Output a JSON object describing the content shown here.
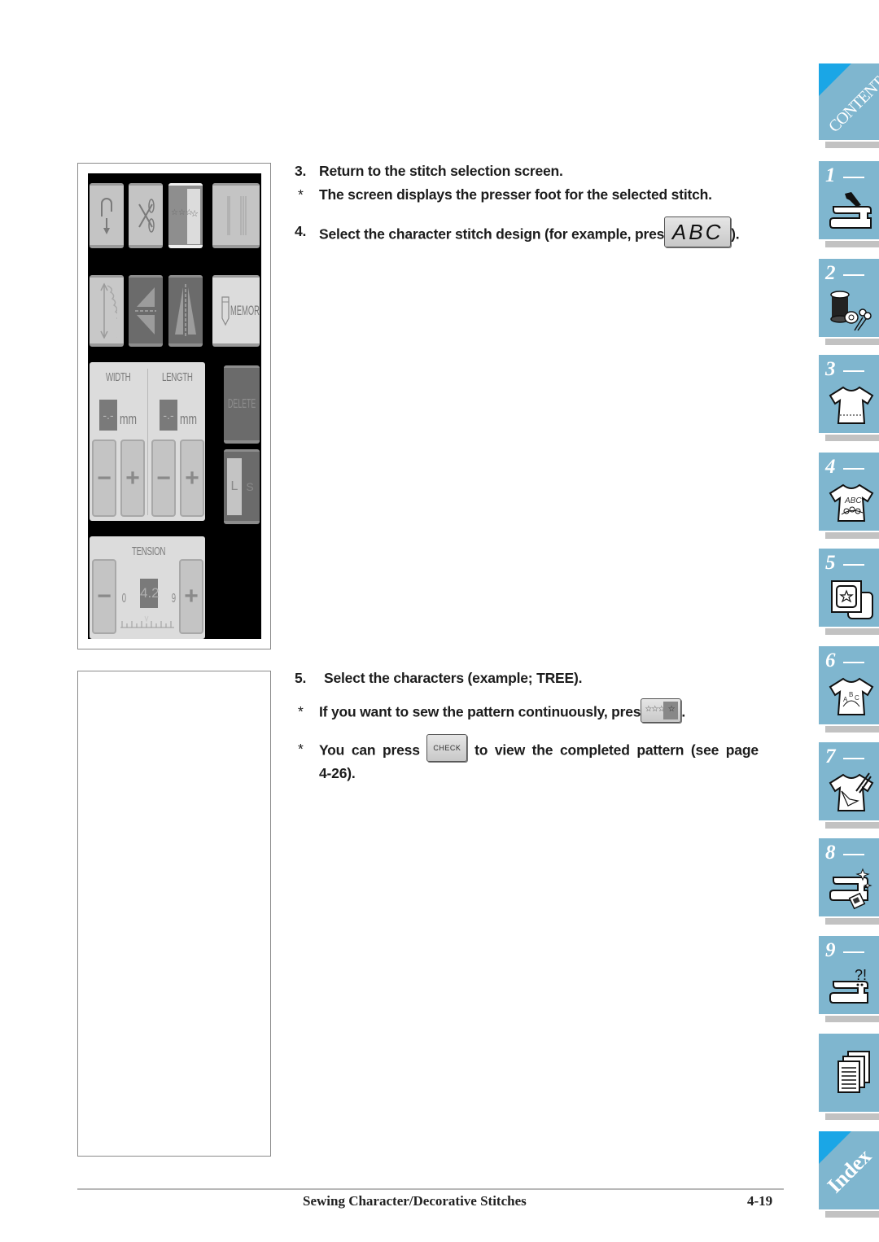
{
  "figure1": {
    "buttons_row1": [
      "reverse-stitch",
      "thread-cutter",
      "single-continuous",
      "needle-mode"
    ],
    "buttons_row2": [
      "elongation",
      "mirror-horizontal",
      "mirror-vertical",
      "memory"
    ],
    "memory_label": "MEMORY",
    "width_label": "WIDTH",
    "length_label": "LENGTH",
    "width_value": "-.-",
    "length_value": "-.-",
    "unit": "mm",
    "minus": "−",
    "plus": "+",
    "delete_label": "DELETE",
    "size_large": "L",
    "size_small": "S",
    "tension_label": "TENSION",
    "tension_value": "4.2",
    "tension_min": "0",
    "tension_max": "9"
  },
  "steps": {
    "s3_num": "3.",
    "s3_text": "Return to the stitch selection screen.",
    "s3_note_bullet": "*",
    "s3_note": "The screen displays the presser foot for the selected stitch.",
    "s4_num": "4.",
    "s4_text_before": "Select the character stitch design (for example, pres",
    "s4_button": "ABC",
    "s4_text_after": ").",
    "s5_num": "5.",
    "s5_text": "Select the characters (example; TREE).",
    "s5_note1_bullet": "*",
    "s5_note1_before": "If you want to sew the pattern continuously, pres",
    "s5_note1_button_stars": "☆☆☆",
    "s5_note1_button_star": "☆",
    "s5_note1_after": ".",
    "s5_note2_bullet": "*",
    "s5_note2_before": "You can press",
    "s5_note2_button": "CHECK",
    "s5_note2_after": "to view the completed pattern (see page",
    "s5_note2_line2": "4-26)."
  },
  "tabs": [
    {
      "label": "CONTENTS"
    },
    {
      "num": "1",
      "icon": "sewing-machine-hand"
    },
    {
      "num": "2",
      "icon": "thread-bobbin-scissors"
    },
    {
      "num": "3",
      "icon": "shirt-seam"
    },
    {
      "num": "4",
      "icon": "shirt-abc-embroidery"
    },
    {
      "num": "5",
      "icon": "embroidery-hoop-star"
    },
    {
      "num": "6",
      "icon": "shirt-abc-arc"
    },
    {
      "num": "7",
      "icon": "shirt-pen"
    },
    {
      "num": "8",
      "icon": "sewing-machine-sparkle"
    },
    {
      "num": "9",
      "icon": "sewing-machine-question"
    },
    {
      "icon": "documents"
    },
    {
      "label": "Index"
    }
  ],
  "footer": {
    "title": "Sewing Character/Decorative Stitches",
    "page": "4-19"
  }
}
